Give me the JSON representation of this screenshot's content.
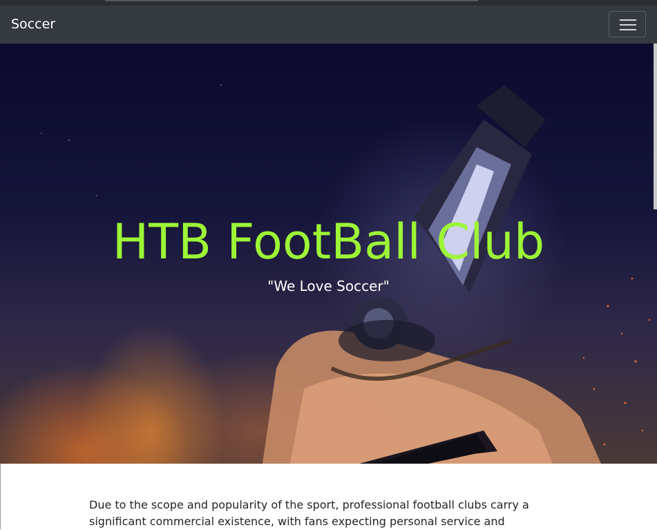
{
  "navbar": {
    "brand": "Soccer",
    "menu_toggle_icon": "hamburger-icon"
  },
  "hero": {
    "title": "HTB FootBall Club",
    "subtitle": "\"We Love Soccer\"",
    "title_color": "#9cf536"
  },
  "content": {
    "paragraph": "Due to the scope and popularity of the sport, professional football clubs carry a significant commercial existence, with fans expecting personal service and"
  },
  "colors": {
    "navbar_bg": "#343a40",
    "body_bg": "#ffffff",
    "text": "#212529"
  }
}
